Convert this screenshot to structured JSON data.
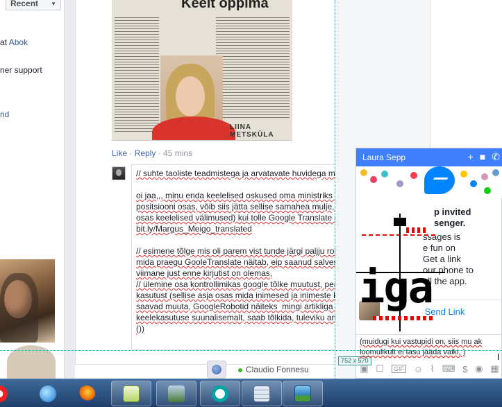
{
  "left": {
    "recent_label": "Recent",
    "line1_prefix": "at",
    "line1_link": "Abok",
    "line2": "ner support",
    "line3": "nd"
  },
  "post": {
    "image_headline": "Keelt oppima",
    "image_caption": "LIINA METSKÜLA",
    "like_label": "Like",
    "reply_label": "Reply",
    "time": "45 mins",
    "comment_text": "// suhte taoliste teadmistega ja arvatavate huvidega maailm\n\noi jaa,,, minu enda keelelised oskused oma ministriks par\npositsiooni osas, võib siis jätta sellise samahea mulje, (\nosas keelelised välimused) kui tolle Google Translate õig\nbit.ly/Margus_Meigo_translated\n\n// esimene tõlge mis oli parem vist tunde järgi paljju rohk\nmida praegu GooleTranslate näitab, eip saanud salvestau\nviimane just enne kirjutist on olemas,\n// ülemine osa kontrollimikas google tõlke muutust, peale\nkasutust (sellise asja osas mida inimesed ja inimeste kä\nsaavad muuta, GoogleRobotid näiteks  mingi artikliga seo\nkeelekasutuse suunalisemalt, saab tõlkida, tuleviku anab\n())"
  },
  "contact": {
    "name": "Claudio Fonnesu"
  },
  "chat": {
    "title": "Laura Sepp",
    "invite_bold": "p invited\nsenger.",
    "invite_body": "ssages is\ne fun on\nGet a link\nour phone to\nall the app.",
    "send_link_label": "Send Link",
    "dimension_label": "752 x 570",
    "input_text": "(muidugi kui vastupidi on, siis mu ak\nloomulikult ei tasu jääda vaiki, )",
    "zoom_text": "iga"
  },
  "taskbar": {
    "apps": [
      "opera-icon",
      "ie-icon",
      "firefox-icon",
      "notepad-plus-icon",
      "network-monitor-icon",
      "eset-icon",
      "calculator-icon",
      "image-viewer-icon"
    ]
  },
  "colors": {
    "facebook_blue": "#4267b2",
    "messenger_blue": "#4080ff",
    "taskbar": "#1e3f6a"
  }
}
